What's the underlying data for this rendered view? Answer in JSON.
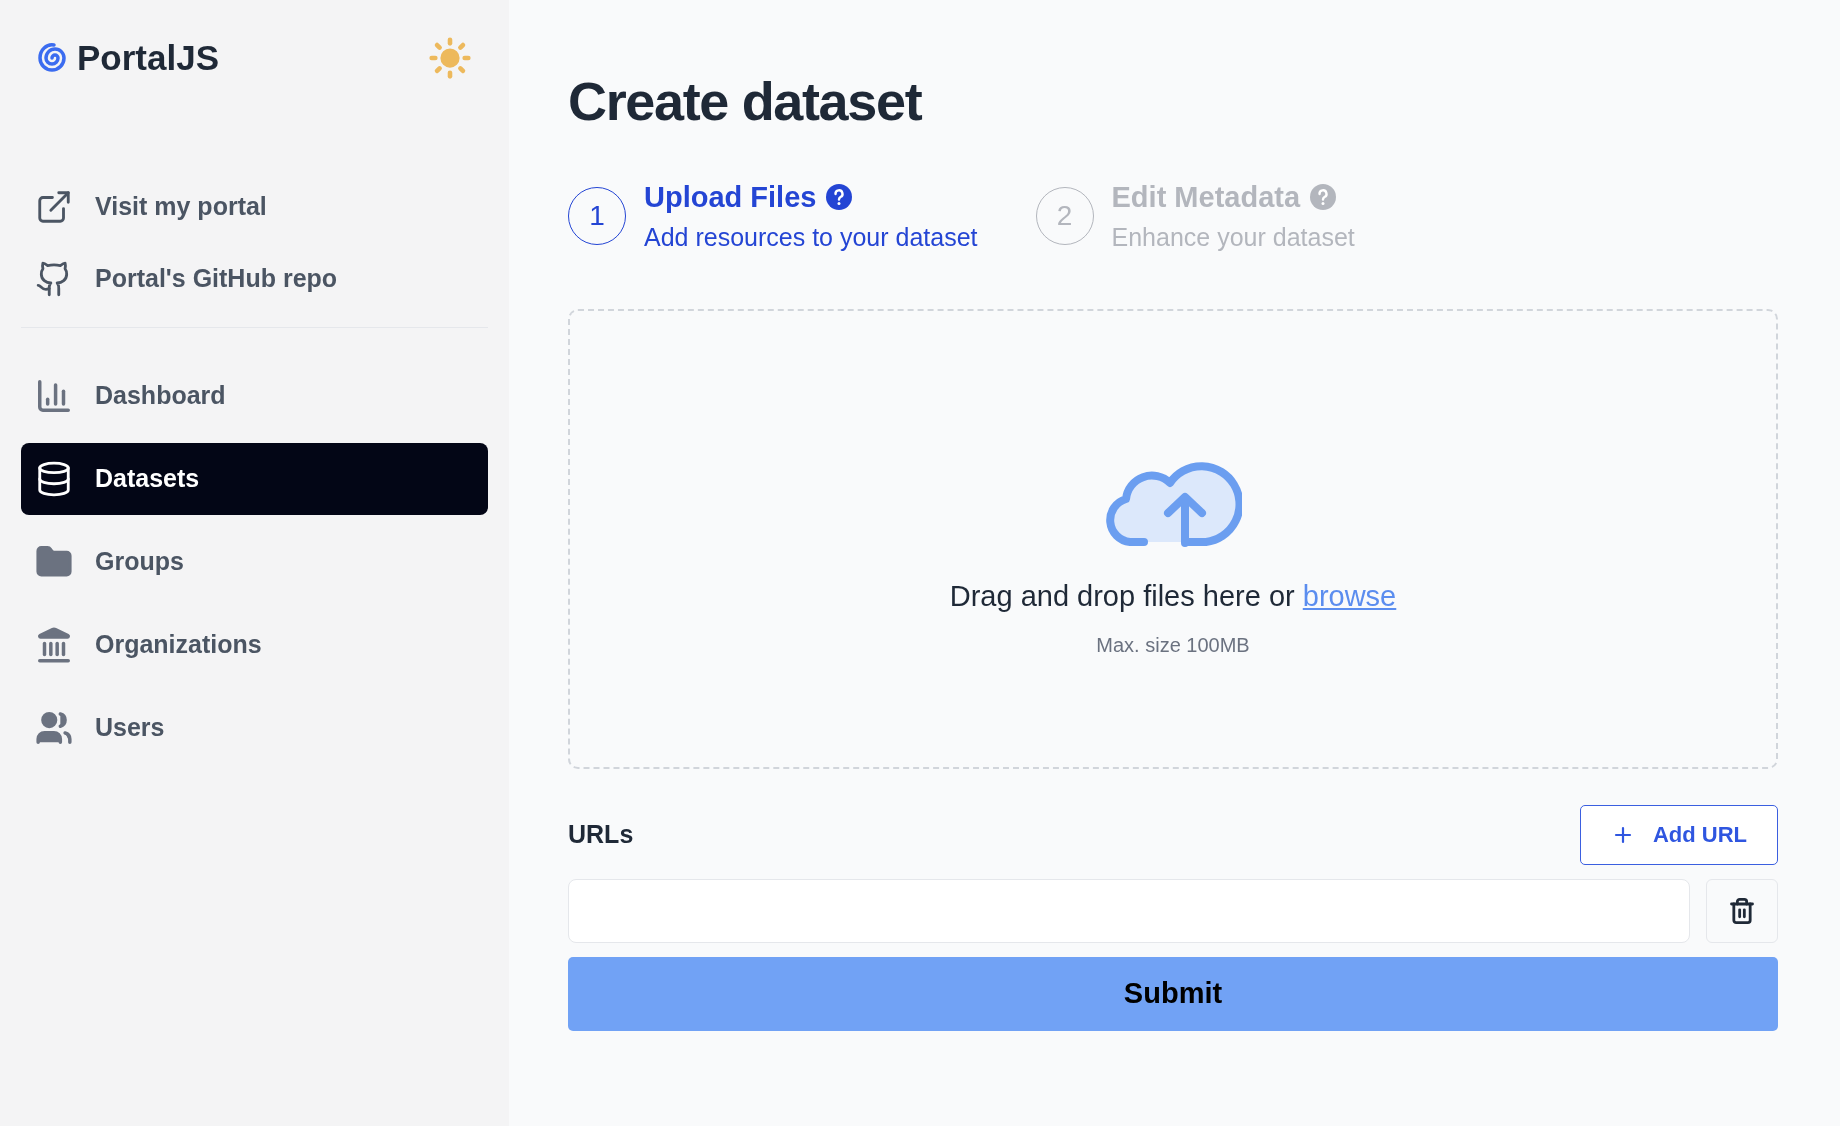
{
  "sidebar": {
    "logo": "PortalJS",
    "links": [
      {
        "label": "Visit my portal"
      },
      {
        "label": "Portal's GitHub repo"
      }
    ],
    "items": [
      {
        "label": "Dashboard",
        "selected": false
      },
      {
        "label": "Datasets",
        "selected": true
      },
      {
        "label": "Groups",
        "selected": false
      },
      {
        "label": "Organizations",
        "selected": false
      },
      {
        "label": "Users",
        "selected": false
      }
    ]
  },
  "title": "Create dataset",
  "steps": [
    {
      "number": "1",
      "title": "Upload Files",
      "subtitle": "Add resources to your dataset",
      "selected": true
    },
    {
      "number": "2",
      "title": "Edit Metadata",
      "subtitle": "Enhance your dataset",
      "selected": false
    }
  ],
  "dropzone": {
    "text": "Drag and drop files here or",
    "link": "browse",
    "hint": "Max. size 100MB"
  },
  "urls": {
    "label": "URLs",
    "add_button": "Add URL"
  },
  "submit": "Submit"
}
